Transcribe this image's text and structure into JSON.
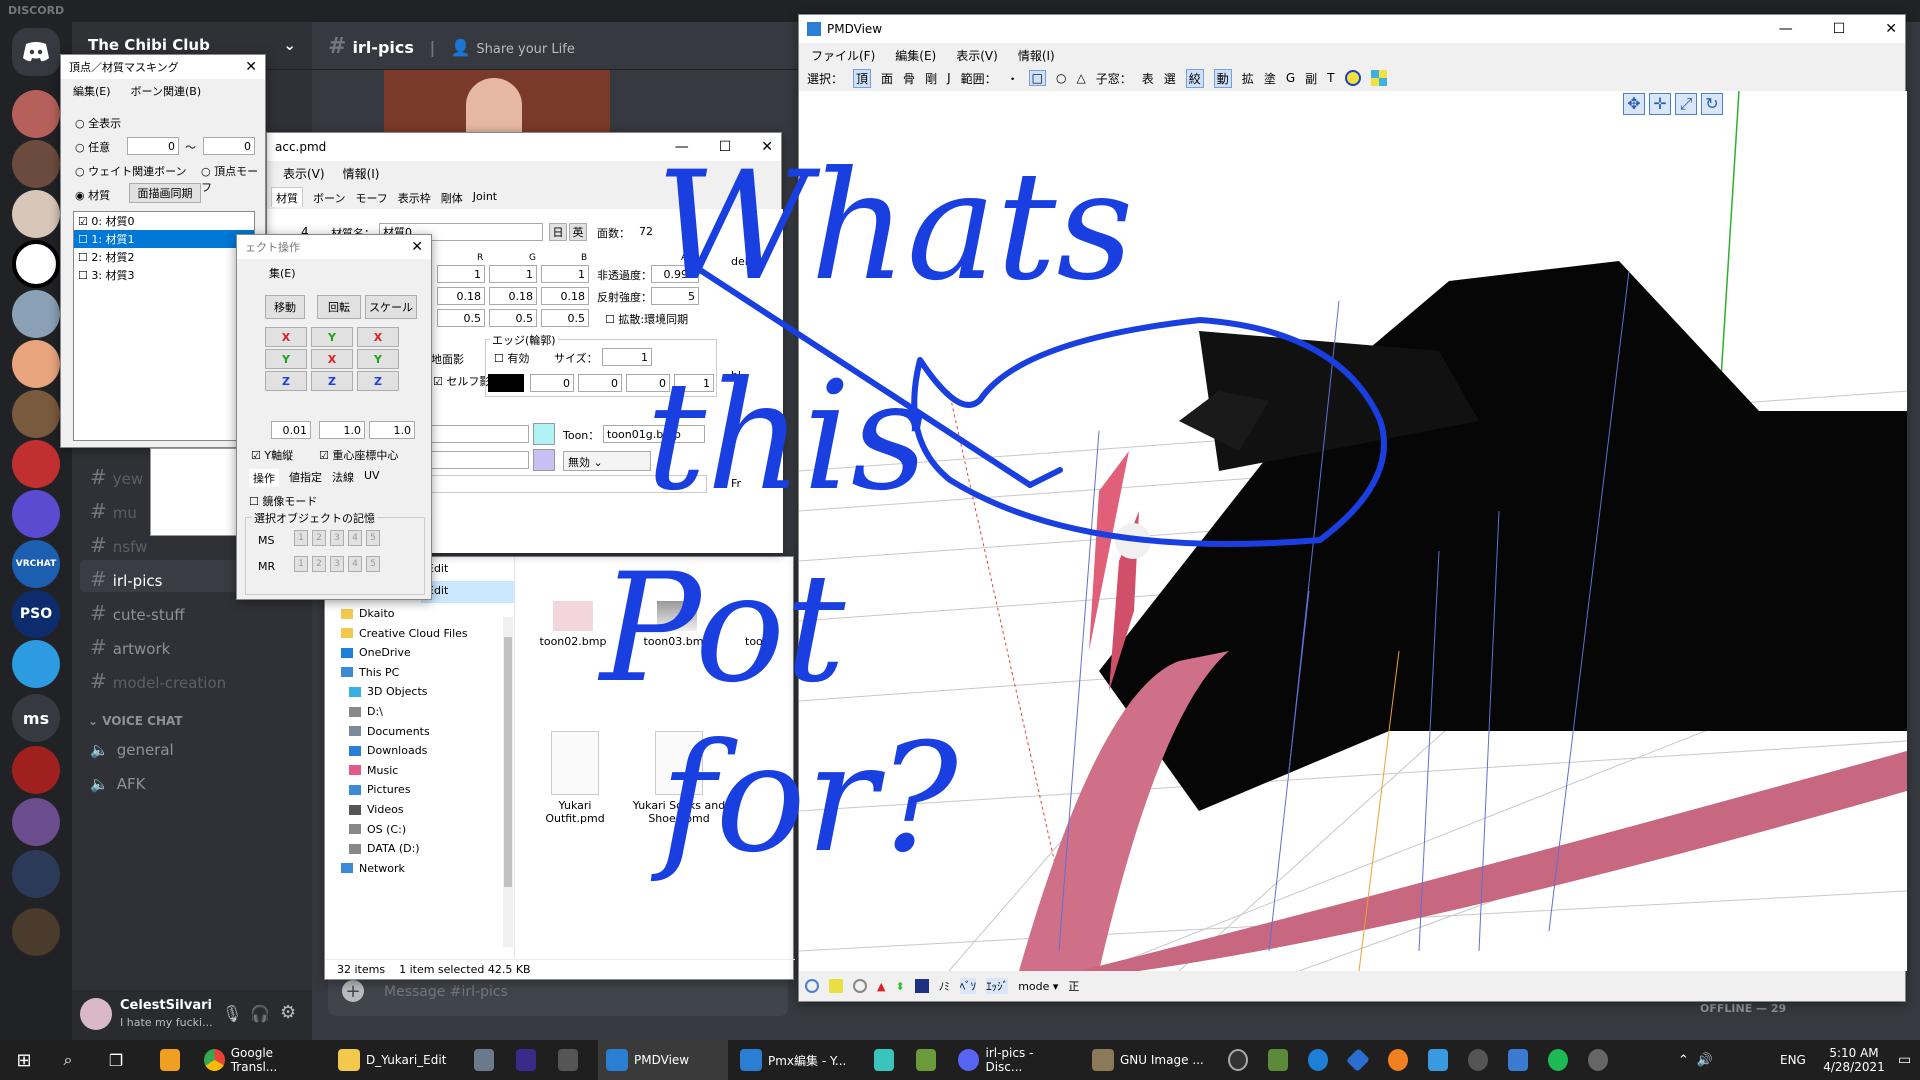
{
  "discord": {
    "brand": "DISCORD",
    "server_name": "The Chibi Club",
    "channel": "irl-pics",
    "topic": "Share your Life",
    "text_channels": [
      "yew",
      "mu",
      "nsfw",
      "irl-pics",
      "cute-stuff",
      "artwork",
      "model-creation"
    ],
    "voice_header": "VOICE CHAT",
    "voice_channels": [
      "general",
      "AFK"
    ],
    "guild_labels": [
      "VRCHAT",
      "PSO",
      "ms"
    ],
    "user": {
      "name": "CelestSilvari",
      "status": "I hate my fucki..."
    },
    "message_placeholder": "Message #irl-pics",
    "offline_header": "OFFLINE — 29",
    "accent": "#5865f2"
  },
  "masking": {
    "title": "頂点／材質マスキング",
    "menu": [
      "編集(E)",
      "ボーン関連(B)"
    ],
    "opt_all": "全表示",
    "opt_any": "任意",
    "any_from": "0",
    "tilde": "〜",
    "any_to": "0",
    "opt_weight": "ウェイト関連ボーン",
    "opt_morph": "頂点モーフ",
    "opt_material": "材質",
    "sync_btn": "面描画同期",
    "materials": [
      "0: 材質0",
      "1: 材質1",
      "2: 材質2",
      "3: 材質3"
    ]
  },
  "pmx": {
    "title": "acc.pmd",
    "menu": [
      "表示(V)",
      "情報(I)"
    ],
    "tabs": [
      "材質",
      "ボーン",
      "モーフ",
      "表示枠",
      "剛体",
      "Joint"
    ],
    "index": "4",
    "mat_name_label": "材質名：",
    "mat_name": "材質0",
    "btn_jp": "日",
    "btn_en": "英",
    "face_label": "面数：",
    "face_count": "72",
    "rgba": [
      "R",
      "G",
      "B",
      "A"
    ],
    "row1": [
      "1",
      "1",
      "1"
    ],
    "row2": [
      "0.18",
      "0.18",
      "0.18"
    ],
    "row3": [
      "0.5",
      "0.5",
      "0.5"
    ],
    "opacity_label": "非透過度：",
    "opacity": "0.999",
    "reflect_label": "反射強度：",
    "reflect": "5",
    "env_sync": "拡散:環境同期",
    "ground_shadow": "地面影",
    "self_shadow": "セルフ影",
    "edge_title": "エッジ(輪郭)",
    "edge_enable": "有効",
    "edge_size_label": "サイズ：",
    "edge_size": "1",
    "edge_rgba": [
      "0",
      "0",
      "0",
      "1"
    ],
    "toon_label": "Toon：",
    "toon_value": "toon01g.bmp",
    "sphere_mode": "無効",
    "side_labels": [
      "del",
      "bl",
      "Fr"
    ]
  },
  "object": {
    "title": "ェクト操作",
    "menu": "集(E)",
    "ops": [
      "移動",
      "回転",
      "スケール"
    ],
    "axes": [
      [
        "X",
        "Y",
        "X"
      ],
      [
        "Y",
        "X",
        "Y"
      ],
      [
        "Z",
        "Z",
        "Z"
      ]
    ],
    "vals": [
      "0.01",
      "1.0",
      "1.0"
    ],
    "y_lock": "Y軸縦",
    "center": "重心座標中心",
    "tabs": [
      "操作",
      "値指定",
      "法線",
      "UV"
    ],
    "mirror": "鏡像モード",
    "memory_title": "選択オブジェクトの記憶",
    "ms": "MS",
    "mr": "MR",
    "slots": [
      "1",
      "2",
      "3",
      "4",
      "5"
    ]
  },
  "explorer": {
    "edit_items": [
      "Edit",
      "Edit"
    ],
    "tree": [
      "Dkaito",
      "Creative Cloud Files",
      "OneDrive",
      "This PC",
      "3D Objects",
      "D:\\",
      "Documents",
      "Downloads",
      "Music",
      "Pictures",
      "Videos",
      "OS (C:)",
      "DATA (D:)",
      "Network"
    ],
    "files": [
      "toon02.bmp",
      "toon03.bmp",
      "toon",
      "Yukari Outfit.pmd",
      "Yukari Socks and Shoes.pmd"
    ],
    "status_items": "32 items",
    "status_selected": "1 item selected  42.5 KB"
  },
  "pmdview": {
    "title": "PMDView",
    "menu": [
      "ファイル(F)",
      "編集(E)",
      "表示(V)",
      "情報(I)"
    ],
    "sel_label": "選択：",
    "sel_items": [
      "頂",
      "面",
      "骨",
      "剛",
      "J"
    ],
    "range_label": "範囲：",
    "range_items": [
      "・",
      "□",
      "○",
      "△"
    ],
    "sub_label": "子窓：",
    "sub_items": [
      "表",
      "選",
      "絞",
      "動",
      "拡",
      "塗",
      "G",
      "副",
      "T"
    ],
    "status_labels": [
      "ﾉﾐ",
      "ﾍﾞｿ",
      "ｴｯｼﾞ",
      "mode",
      "正"
    ]
  },
  "annotation": {
    "text": [
      "Whats",
      "this",
      "Pot",
      "for?"
    ],
    "color": "#1a3fe0"
  },
  "taskbar": {
    "apps": [
      "Google Transl...",
      "D_Yukari_Edit",
      "PMDView",
      "Pmx編集 - Y...",
      "irl-pics - Disc...",
      "GNU Image ..."
    ],
    "lang": "ENG",
    "time": "5:10 AM",
    "date": "4/28/2021"
  }
}
